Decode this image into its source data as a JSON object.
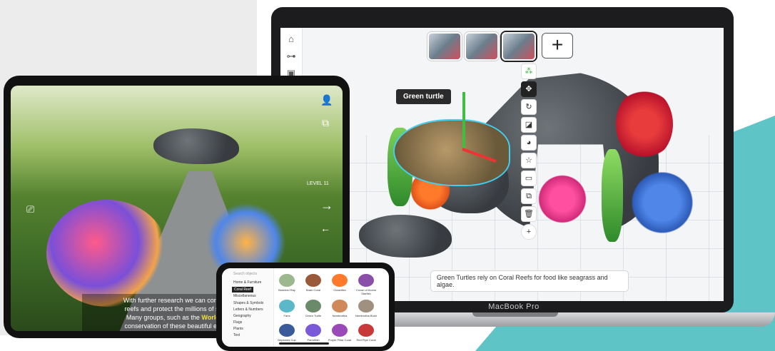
{
  "colors": {
    "teal": "#5ec4c6",
    "tooltip_bg": "#2b2b2b",
    "highlight_text": "#f2e035"
  },
  "macbook": {
    "label": "MacBook Pro",
    "app": {
      "left_rail_icons": [
        "home-icon",
        "toggle-icon",
        "save-icon"
      ],
      "scenes": [
        {
          "index": "1"
        },
        {
          "index": "2"
        },
        {
          "index": "3",
          "active": true
        }
      ],
      "add_scene_label": "+",
      "selected_object_tooltip": "Green turtle",
      "toolbar_icons": [
        "group-icon",
        "move-icon",
        "rotate-icon",
        "scale-icon",
        "color-icon",
        "star-icon",
        "comment-icon",
        "duplicate-icon",
        "delete-icon",
        "add-icon"
      ],
      "caption": "Green Turtles rely on Coral Reefs for food like seagrass and algae."
    }
  },
  "ipad": {
    "level_label": "LEVEL 11",
    "caption_parts": {
      "line1": "With further research we can continue to find wa",
      "line2": "reefs and protect the millions of species who ca",
      "line3_pre": "Many groups, such as the ",
      "line3_highlight": "World Wildlife Fun",
      "line4": "conservation of these beautiful ecosystems. Ge"
    },
    "icons": [
      "add-person-icon",
      "share-icon",
      "camera-icon",
      "arrow-right-icon",
      "arrow-left-icon"
    ]
  },
  "iphone": {
    "search_placeholder": "Search objects",
    "categories": [
      "Home & Furniture",
      "Coral Reef",
      "Miscellaneous",
      "Shapes & Symbols",
      "Letters & Numbers",
      "Geography",
      "Flags",
      "Plants",
      "Text"
    ],
    "selected_category": "Coral Reef",
    "items": [
      "Blotched Ray",
      "Brain Coral",
      "Clownfish",
      "Crown of thorns Starfish",
      "Fans",
      "Green Turtle",
      "Nembrothia",
      "Nembrotha Bush",
      "Neptunes Cup",
      "Parrotfish",
      "Purple Pillar Coral",
      "Red Pipe Coral"
    ]
  }
}
